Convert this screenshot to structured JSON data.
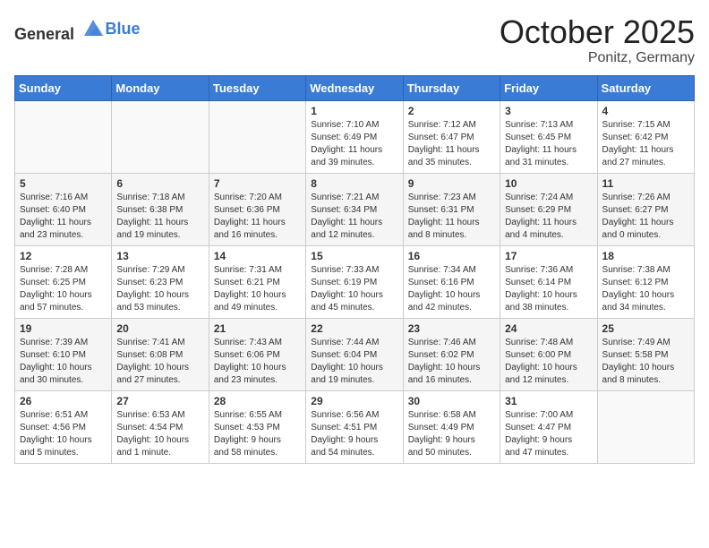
{
  "header": {
    "logo_general": "General",
    "logo_blue": "Blue",
    "month": "October 2025",
    "location": "Ponitz, Germany"
  },
  "weekdays": [
    "Sunday",
    "Monday",
    "Tuesday",
    "Wednesday",
    "Thursday",
    "Friday",
    "Saturday"
  ],
  "weeks": [
    [
      {
        "day": "",
        "info": ""
      },
      {
        "day": "",
        "info": ""
      },
      {
        "day": "",
        "info": ""
      },
      {
        "day": "1",
        "info": "Sunrise: 7:10 AM\nSunset: 6:49 PM\nDaylight: 11 hours\nand 39 minutes."
      },
      {
        "day": "2",
        "info": "Sunrise: 7:12 AM\nSunset: 6:47 PM\nDaylight: 11 hours\nand 35 minutes."
      },
      {
        "day": "3",
        "info": "Sunrise: 7:13 AM\nSunset: 6:45 PM\nDaylight: 11 hours\nand 31 minutes."
      },
      {
        "day": "4",
        "info": "Sunrise: 7:15 AM\nSunset: 6:42 PM\nDaylight: 11 hours\nand 27 minutes."
      }
    ],
    [
      {
        "day": "5",
        "info": "Sunrise: 7:16 AM\nSunset: 6:40 PM\nDaylight: 11 hours\nand 23 minutes."
      },
      {
        "day": "6",
        "info": "Sunrise: 7:18 AM\nSunset: 6:38 PM\nDaylight: 11 hours\nand 19 minutes."
      },
      {
        "day": "7",
        "info": "Sunrise: 7:20 AM\nSunset: 6:36 PM\nDaylight: 11 hours\nand 16 minutes."
      },
      {
        "day": "8",
        "info": "Sunrise: 7:21 AM\nSunset: 6:34 PM\nDaylight: 11 hours\nand 12 minutes."
      },
      {
        "day": "9",
        "info": "Sunrise: 7:23 AM\nSunset: 6:31 PM\nDaylight: 11 hours\nand 8 minutes."
      },
      {
        "day": "10",
        "info": "Sunrise: 7:24 AM\nSunset: 6:29 PM\nDaylight: 11 hours\nand 4 minutes."
      },
      {
        "day": "11",
        "info": "Sunrise: 7:26 AM\nSunset: 6:27 PM\nDaylight: 11 hours\nand 0 minutes."
      }
    ],
    [
      {
        "day": "12",
        "info": "Sunrise: 7:28 AM\nSunset: 6:25 PM\nDaylight: 10 hours\nand 57 minutes."
      },
      {
        "day": "13",
        "info": "Sunrise: 7:29 AM\nSunset: 6:23 PM\nDaylight: 10 hours\nand 53 minutes."
      },
      {
        "day": "14",
        "info": "Sunrise: 7:31 AM\nSunset: 6:21 PM\nDaylight: 10 hours\nand 49 minutes."
      },
      {
        "day": "15",
        "info": "Sunrise: 7:33 AM\nSunset: 6:19 PM\nDaylight: 10 hours\nand 45 minutes."
      },
      {
        "day": "16",
        "info": "Sunrise: 7:34 AM\nSunset: 6:16 PM\nDaylight: 10 hours\nand 42 minutes."
      },
      {
        "day": "17",
        "info": "Sunrise: 7:36 AM\nSunset: 6:14 PM\nDaylight: 10 hours\nand 38 minutes."
      },
      {
        "day": "18",
        "info": "Sunrise: 7:38 AM\nSunset: 6:12 PM\nDaylight: 10 hours\nand 34 minutes."
      }
    ],
    [
      {
        "day": "19",
        "info": "Sunrise: 7:39 AM\nSunset: 6:10 PM\nDaylight: 10 hours\nand 30 minutes."
      },
      {
        "day": "20",
        "info": "Sunrise: 7:41 AM\nSunset: 6:08 PM\nDaylight: 10 hours\nand 27 minutes."
      },
      {
        "day": "21",
        "info": "Sunrise: 7:43 AM\nSunset: 6:06 PM\nDaylight: 10 hours\nand 23 minutes."
      },
      {
        "day": "22",
        "info": "Sunrise: 7:44 AM\nSunset: 6:04 PM\nDaylight: 10 hours\nand 19 minutes."
      },
      {
        "day": "23",
        "info": "Sunrise: 7:46 AM\nSunset: 6:02 PM\nDaylight: 10 hours\nand 16 minutes."
      },
      {
        "day": "24",
        "info": "Sunrise: 7:48 AM\nSunset: 6:00 PM\nDaylight: 10 hours\nand 12 minutes."
      },
      {
        "day": "25",
        "info": "Sunrise: 7:49 AM\nSunset: 5:58 PM\nDaylight: 10 hours\nand 8 minutes."
      }
    ],
    [
      {
        "day": "26",
        "info": "Sunrise: 6:51 AM\nSunset: 4:56 PM\nDaylight: 10 hours\nand 5 minutes."
      },
      {
        "day": "27",
        "info": "Sunrise: 6:53 AM\nSunset: 4:54 PM\nDaylight: 10 hours\nand 1 minute."
      },
      {
        "day": "28",
        "info": "Sunrise: 6:55 AM\nSunset: 4:53 PM\nDaylight: 9 hours\nand 58 minutes."
      },
      {
        "day": "29",
        "info": "Sunrise: 6:56 AM\nSunset: 4:51 PM\nDaylight: 9 hours\nand 54 minutes."
      },
      {
        "day": "30",
        "info": "Sunrise: 6:58 AM\nSunset: 4:49 PM\nDaylight: 9 hours\nand 50 minutes."
      },
      {
        "day": "31",
        "info": "Sunrise: 7:00 AM\nSunset: 4:47 PM\nDaylight: 9 hours\nand 47 minutes."
      },
      {
        "day": "",
        "info": ""
      }
    ]
  ]
}
